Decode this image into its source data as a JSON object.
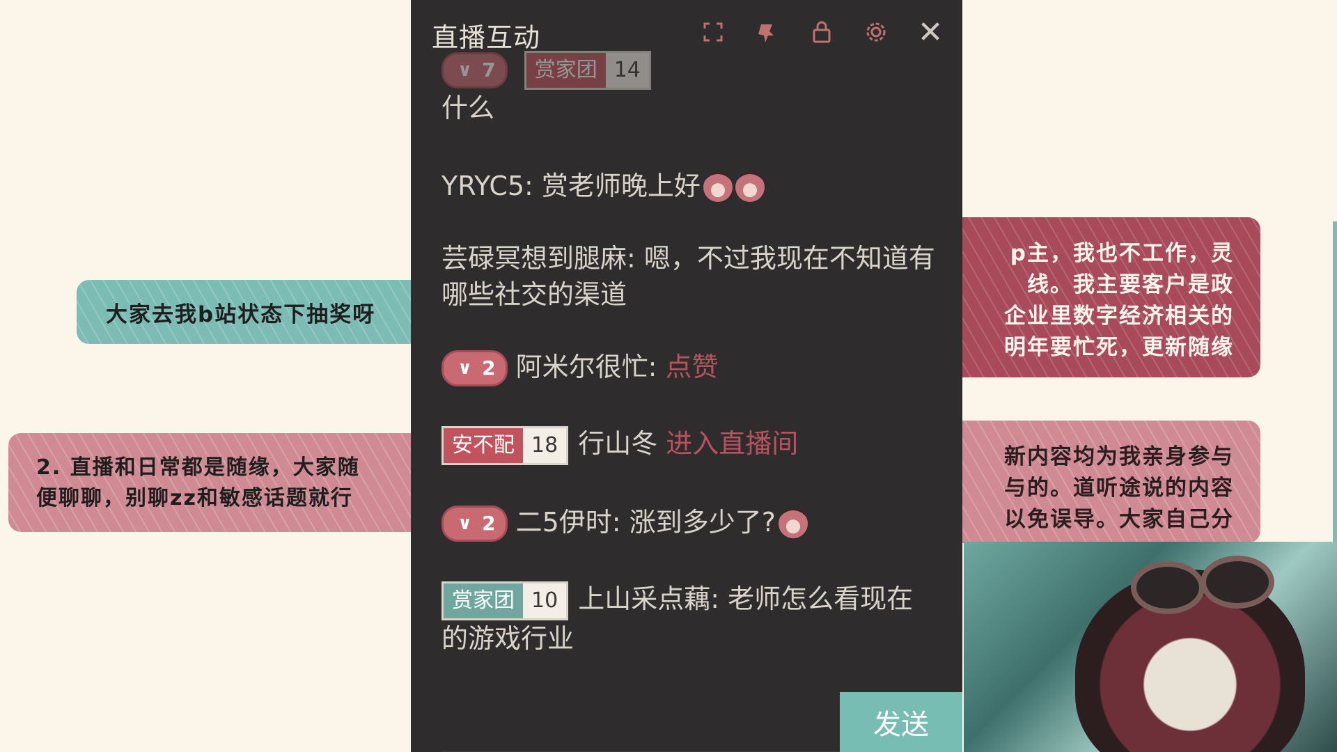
{
  "background": {
    "banner_teal": "大家去我b站状态下抽奖呀",
    "banner_pink_left_line1": "2. 直播和日常都是随缘，大家随",
    "banner_pink_left_line2": "便聊聊，别聊zz和敏感话题就行",
    "banner_pink_r1_line1": "p主，我也不工作，灵",
    "banner_pink_r1_line2": "线。我主要客户是政",
    "banner_pink_r1_line3": "企业里数字经济相关的",
    "banner_pink_r1_line4": "明年要忙死，更新随缘",
    "banner_pink_r2_line1": "新内容均为我亲身参与",
    "banner_pink_r2_line2": "与的。道听途说的内容",
    "banner_pink_r2_line3": "以免误导。大家自己分"
  },
  "panel": {
    "title": "直播互动",
    "icons": [
      "fullscreen-icon",
      "pin-icon",
      "lock-icon",
      "settings-icon",
      "close-icon"
    ],
    "close_glyph": "✕",
    "send_label": "发送"
  },
  "messages": [
    {
      "type": "fan",
      "badge_level": "7",
      "medal_name": "赏家团",
      "medal_level": "14",
      "user": "",
      "text": "什么"
    },
    {
      "type": "plain",
      "user": "YRYC5",
      "text": "赏老师晚上好"
    },
    {
      "type": "plain",
      "user": "芸碌冥想到腿麻",
      "text": "嗯，不过我现在不知道有哪些社交的渠道"
    },
    {
      "type": "fan",
      "badge_level": "2",
      "user": "阿米尔很忙",
      "text": "点赞"
    },
    {
      "type": "enter",
      "medal_name": "安不配",
      "medal_level": "18",
      "user": "行山冬",
      "text": "进入直播间"
    },
    {
      "type": "fan",
      "badge_level": "2",
      "user": "二5伊时",
      "text": "涨到多少了?"
    },
    {
      "type": "medal",
      "medal_name": "赏家团",
      "medal_level": "10",
      "user": "上山采点藕",
      "text": "老师怎么看现在的游戏行业"
    }
  ],
  "colors": {
    "panel_bg": "#2e2c2d",
    "accent_teal": "#78bdb4",
    "accent_pink": "#c96a72"
  }
}
